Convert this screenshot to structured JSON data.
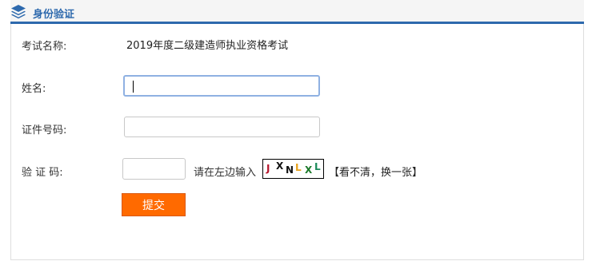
{
  "panel": {
    "title": "身份验证",
    "icon": "layers-icon",
    "accent_color": "#2d69ad"
  },
  "form": {
    "exam": {
      "label": "考试名称:",
      "value": "2019年度二级建造师执业资格考试"
    },
    "name": {
      "label": "姓名:",
      "value": ""
    },
    "id_number": {
      "label": "证件号码:",
      "value": ""
    },
    "captcha": {
      "label": "验 证 码:",
      "value": "",
      "hint": "请在左边输入",
      "characters": [
        {
          "ch": "J",
          "color": "#b5142b"
        },
        {
          "ch": "X",
          "color": "#111111"
        },
        {
          "ch": "N",
          "color": "#111111"
        },
        {
          "ch": "L",
          "color": "#e8a21a"
        },
        {
          "ch": "X",
          "color": "#1d7a2b"
        },
        {
          "ch": "L",
          "color": "#1a8a5a"
        }
      ],
      "refresh_label": "【看不清，换一张】"
    },
    "submit_label": "提交",
    "submit_color": "#ff6a00"
  }
}
